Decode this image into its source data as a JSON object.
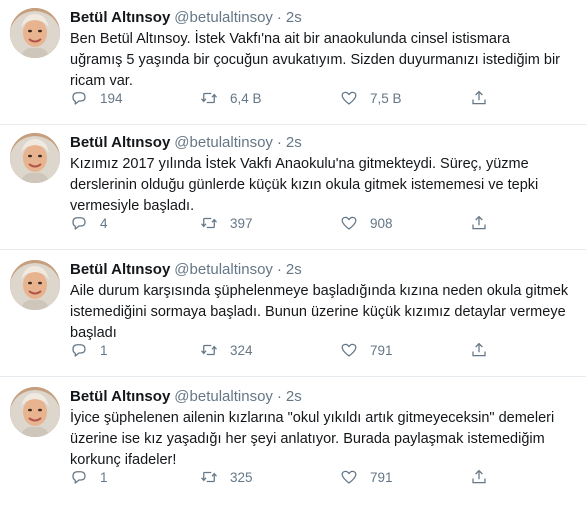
{
  "tweets": [
    {
      "name": "Betül Altınsoy",
      "handle": "@betulaltinsoy",
      "sep": "·",
      "time": "2s",
      "lines": [
        "Ben Betül Altınsoy.  İstek Vakfı'na ait bir anaokulunda cinsel istismara",
        "uğramış 5 yaşında bir çocuğun avukatıyım. Sizden duyurmanızı istediğim bir",
        "ricam var."
      ],
      "replies": "194",
      "retweets": "6,4 B",
      "likes": "7,5 B"
    },
    {
      "name": "Betül Altınsoy",
      "handle": "@betulaltinsoy",
      "sep": "·",
      "time": "2s",
      "lines": [
        "Kızımız 2017 yılında İstek Vakfı Anaokulu'na gitmekteydi. Süreç, yüzme",
        "derslerinin olduğu günlerde küçük kızın okula gitmek istememesi ve tepki",
        "vermesiyle başladı."
      ],
      "replies": "4",
      "retweets": "397",
      "likes": "908"
    },
    {
      "name": "Betül Altınsoy",
      "handle": "@betulaltinsoy",
      "sep": "·",
      "time": "2s",
      "lines": [
        "Aile durum karşısında şüphelenmeye başladığında kızına neden okula gitmek",
        "istemediğini sormaya başladı. Bunun üzerine küçük kızımız detaylar vermeye",
        "başladı"
      ],
      "replies": "1",
      "retweets": "324",
      "likes": "791"
    },
    {
      "name": "Betül Altınsoy",
      "handle": "@betulaltinsoy",
      "sep": "·",
      "time": "2s",
      "lines": [
        "İyice şüphelenen ailenin kızlarına \"okul yıkıldı artık gitmeyeceksin\" demeleri",
        "üzerine ise kız yaşadığı her şeyi anlatıyor. Burada paylaşmak istemediğim",
        "korkunç ifadeler!"
      ],
      "replies": "1",
      "retweets": "325",
      "likes": "791"
    }
  ],
  "icons": {
    "reply": "reply-icon",
    "retweet": "retweet-icon",
    "like": "heart-icon",
    "share": "share-icon"
  },
  "colors": {
    "muted": "#657786",
    "text": "#14171a",
    "divider": "#e6ecf0"
  }
}
